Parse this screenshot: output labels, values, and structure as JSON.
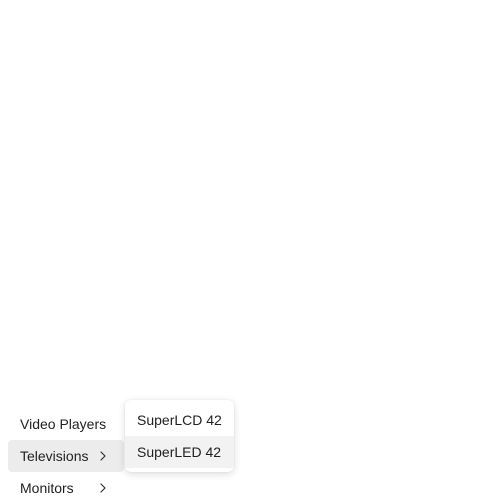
{
  "menu": {
    "items": [
      {
        "label": "Video Players",
        "has_submenu": false
      },
      {
        "label": "Televisions",
        "has_submenu": true,
        "icon": "chevron-right-icon"
      },
      {
        "label": "Monitors",
        "has_submenu": true,
        "icon": "chevron-right-icon"
      }
    ]
  },
  "submenu": {
    "items": [
      {
        "label": "SuperLCD 42"
      },
      {
        "label": "SuperLED 42"
      }
    ]
  },
  "colors": {
    "hover_bg": "#ececec",
    "submenu_hover_bg": "#f2f2f2",
    "text": "#1f1f1f"
  }
}
